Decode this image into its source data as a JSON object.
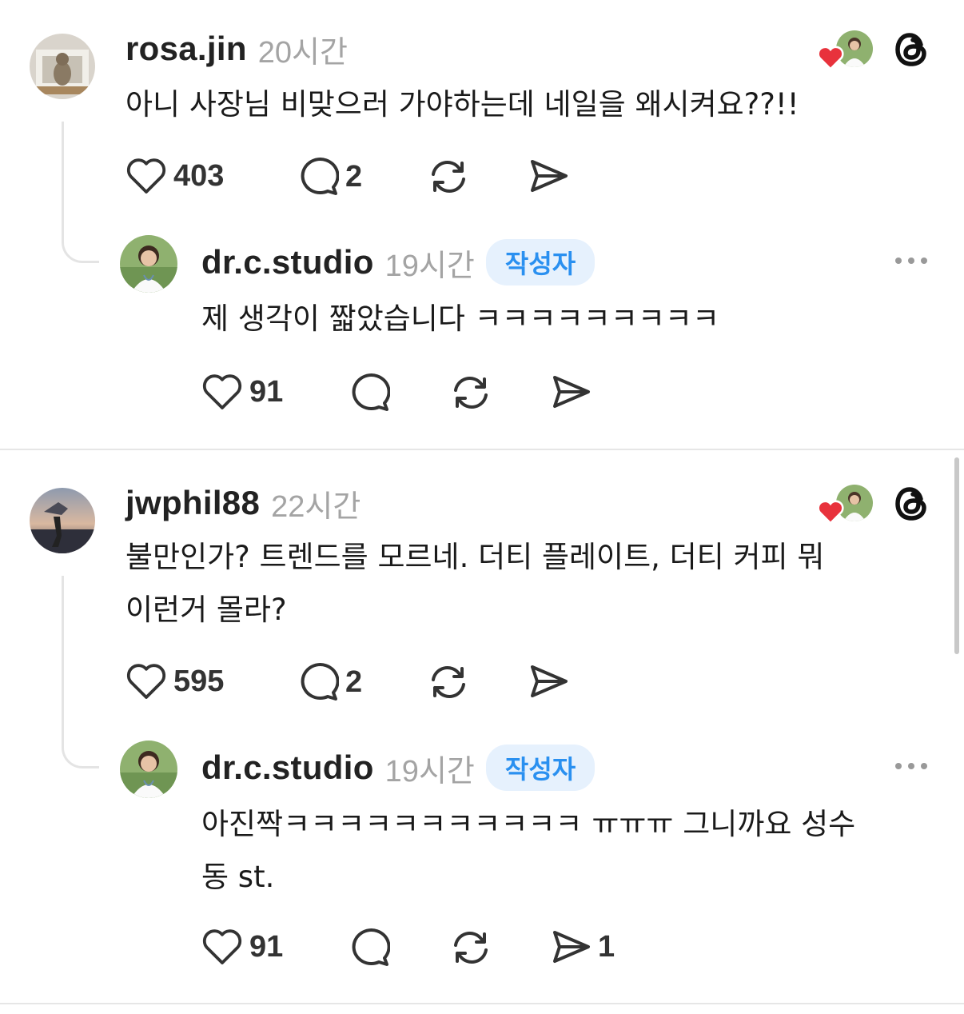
{
  "threads": [
    {
      "post": {
        "username": "rosa.jin",
        "time": "20시간",
        "text": "아니 사장님 비맞으러 가야하는데 네일을 왜시켜요??!!",
        "likes": "403",
        "replies": "2"
      },
      "reply": {
        "username": "dr.c.studio",
        "time": "19시간",
        "badge": "작성자",
        "text": "제 생각이 짧았습니다 ㅋㅋㅋㅋㅋㅋㅋㅋㅋ",
        "likes": "91"
      }
    },
    {
      "post": {
        "username": "jwphil88",
        "time": "22시간",
        "text": "불만인가? 트렌드를 모르네. 더티 플레이트, 더티 커피 뭐\n이런거 몰라?",
        "likes": "595",
        "replies": "2"
      },
      "reply": {
        "username": "dr.c.studio",
        "time": "19시간",
        "badge": "작성자",
        "text": "아진짝ㅋㅋㅋㅋㅋㅋㅋㅋㅋㅋㅋ ㅠㅠㅠ 그니까요 성수\n동 st.",
        "likes": "91",
        "shares": "1"
      }
    }
  ],
  "colors": {
    "heart": "#e8323c",
    "badge_bg": "#e6f1fd",
    "badge_text": "#2a90f0"
  },
  "icons": [
    "heart-icon",
    "comment-icon",
    "repost-icon",
    "share-icon",
    "threads-icon",
    "more-icon"
  ]
}
